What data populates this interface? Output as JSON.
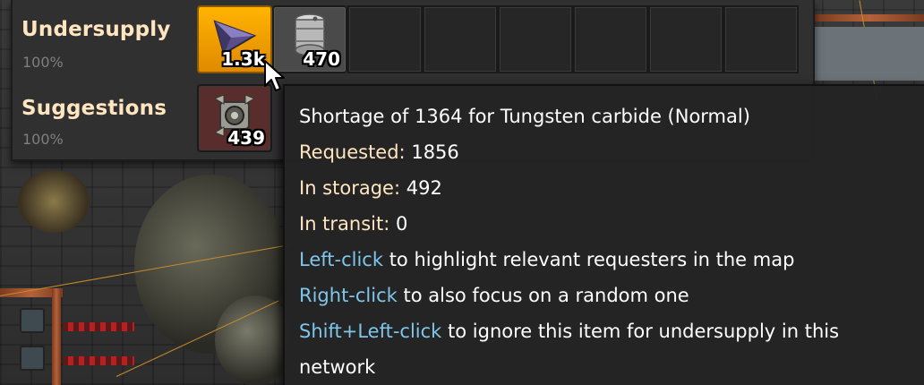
{
  "panel": {
    "rows": [
      {
        "label": "Undersupply",
        "percent": "100%",
        "slots": [
          {
            "icon": "tungsten-carbide-icon",
            "count": "1.3k",
            "state": "selected"
          },
          {
            "icon": "barrel-icon",
            "count": "470",
            "state": "filled"
          },
          {
            "state": "empty"
          },
          {
            "state": "empty"
          },
          {
            "state": "empty"
          },
          {
            "state": "empty"
          },
          {
            "state": "empty"
          },
          {
            "state": "empty"
          }
        ]
      },
      {
        "label": "Suggestions",
        "percent": "100%",
        "slots": [
          {
            "icon": "electric-mining-drill-icon",
            "count": "439",
            "state": "reddish"
          }
        ]
      }
    ]
  },
  "tooltip": {
    "title": "Shortage of 1364 for Tungsten carbide (Normal)",
    "requested_label": "Requested:",
    "requested_value": "1856",
    "storage_label": "In storage:",
    "storage_value": "492",
    "transit_label": "In transit:",
    "transit_value": "0",
    "action1_key": "Left-click",
    "action1_text": "to highlight relevant requesters in the map",
    "action2_key": "Right-click",
    "action2_text": "to also focus on a random one",
    "action3_key": "Shift+Left-click",
    "action3_text": "to ignore this item for undersupply in this network"
  },
  "colors": {
    "label": "#ffe6c0",
    "action": "#7fc6ec",
    "selected_slot": "#ffb400"
  }
}
